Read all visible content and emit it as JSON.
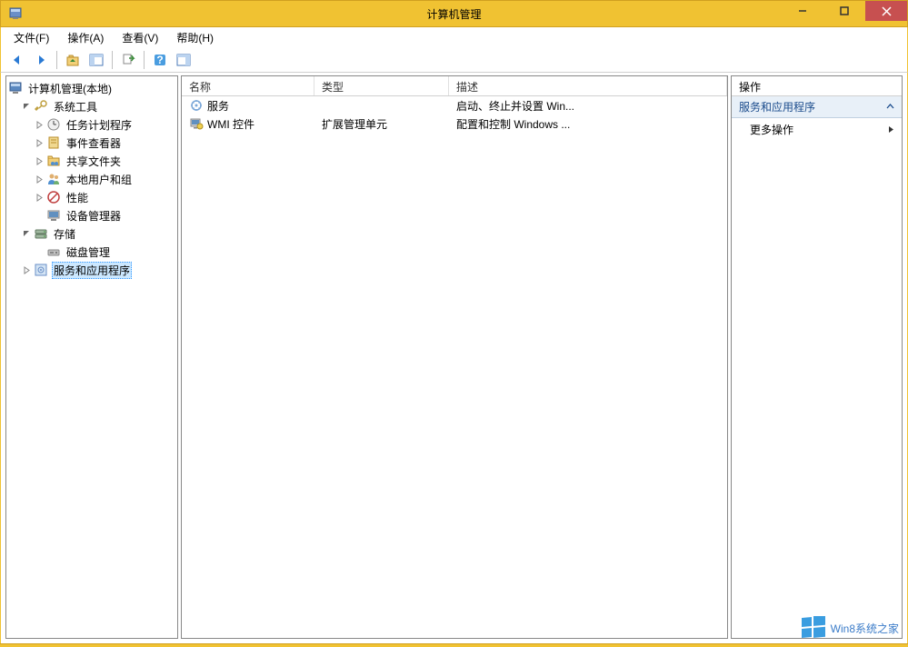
{
  "window": {
    "title": "计算机管理"
  },
  "menu": {
    "file": "文件(F)",
    "action": "操作(A)",
    "view": "查看(V)",
    "help": "帮助(H)"
  },
  "tree": {
    "root": "计算机管理(本地)",
    "system_tools": "系统工具",
    "task_scheduler": "任务计划程序",
    "event_viewer": "事件查看器",
    "shared_folders": "共享文件夹",
    "local_users": "本地用户和组",
    "performance": "性能",
    "device_manager": "设备管理器",
    "storage": "存储",
    "disk_mgmt": "磁盘管理",
    "services_apps": "服务和应用程序"
  },
  "list": {
    "headers": {
      "name": "名称",
      "type": "类型",
      "desc": "描述"
    },
    "rows": [
      {
        "name": "服务",
        "type": "",
        "desc": "启动、终止并设置 Win..."
      },
      {
        "name": "WMI 控件",
        "type": "扩展管理单元",
        "desc": "配置和控制 Windows ..."
      }
    ]
  },
  "actions": {
    "header": "操作",
    "section": "服务和应用程序",
    "more": "更多操作"
  },
  "watermark": "Win8系统之家"
}
